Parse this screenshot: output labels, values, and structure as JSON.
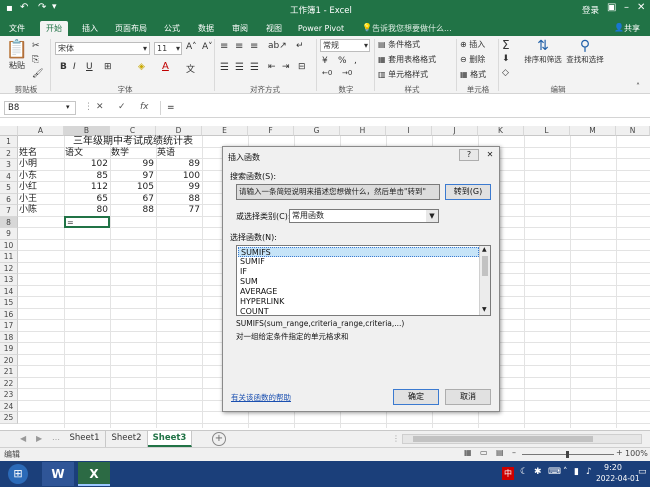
{
  "titlebar": {
    "title": "工作簿1 - Excel",
    "login": "登录"
  },
  "tabs": [
    {
      "label": "文件"
    },
    {
      "label": "开始"
    },
    {
      "label": "插入"
    },
    {
      "label": "页面布局"
    },
    {
      "label": "公式"
    },
    {
      "label": "数据"
    },
    {
      "label": "审阅"
    },
    {
      "label": "视图"
    },
    {
      "label": "Power Pivot"
    }
  ],
  "tell_me": "告诉我您想要做什么...",
  "share": "共享",
  "ribbon": {
    "paste": "粘贴",
    "font_name": "宋体",
    "font_size": "11",
    "bold": "B",
    "italic": "I",
    "underline": "U",
    "font_color_glyph": "A",
    "number_format": "常规",
    "conditional": "条件格式",
    "table_format": "套用表格格式",
    "cell_style": "单元格样式",
    "insert": "插入",
    "delete": "删除",
    "format": "格式",
    "sigma": "Σ",
    "sort_filter": "排序和筛选",
    "find_select": "查找和选择",
    "groups": {
      "clipboard": "剪贴板",
      "font": "字体",
      "alignment": "对齐方式",
      "number": "数字",
      "styles": "样式",
      "cells": "单元格",
      "editing": "编辑"
    }
  },
  "formula_bar": {
    "name_box": "B8",
    "value": "=",
    "fx": "fx",
    "cancel": "✕",
    "enter": "✓"
  },
  "columns": [
    "A",
    "B",
    "C",
    "D",
    "E",
    "F",
    "G",
    "H",
    "I",
    "J",
    "K",
    "L",
    "M",
    "N"
  ],
  "rows": [
    "1",
    "2",
    "3",
    "4",
    "5",
    "6",
    "7",
    "8",
    "9",
    "10",
    "11",
    "12",
    "13",
    "14",
    "15",
    "16",
    "17",
    "18",
    "19",
    "20",
    "21",
    "22",
    "23",
    "24",
    "25"
  ],
  "sheet": {
    "title": "三年级期中考试成绩统计表",
    "headers": [
      "姓名",
      "语文",
      "数学",
      "英语"
    ],
    "data": [
      {
        "name": "小明",
        "chinese": "102",
        "math": "99",
        "english": "89"
      },
      {
        "name": "小东",
        "chinese": "85",
        "math": "97",
        "english": "100"
      },
      {
        "name": "小红",
        "chinese": "112",
        "math": "105",
        "english": "99"
      },
      {
        "name": "小王",
        "chinese": "65",
        "math": "67",
        "english": "88"
      },
      {
        "name": "小陈",
        "chinese": "80",
        "math": "88",
        "english": "77"
      }
    ],
    "active_cell_value": "="
  },
  "dialog": {
    "title": "插入函数",
    "help_btn": "?",
    "search_label": "搜索函数(S):",
    "search_text": "请输入一条简短说明来描述您想做什么，然后单击\"转到\"",
    "goto": "转到(G)",
    "category_label": "或选择类别(C):",
    "category_value": "常用函数",
    "select_label": "选择函数(N):",
    "functions": [
      "SUMIFS",
      "SUMIF",
      "IF",
      "SUM",
      "AVERAGE",
      "HYPERLINK",
      "COUNT"
    ],
    "selected_function": "SUMIFS",
    "syntax": "SUMIFS(sum_range,criteria_range,criteria,...)",
    "description": "对一组给定条件指定的单元格求和",
    "help_link": "有关该函数的帮助",
    "ok": "确定",
    "cancel": "取消"
  },
  "sheet_tabs": [
    {
      "label": "Sheet1"
    },
    {
      "label": "Sheet2"
    },
    {
      "label": "Sheet3"
    }
  ],
  "add_sheet": "+",
  "status": {
    "mode": "编辑",
    "zoom": "100%"
  },
  "taskbar": {
    "time": "9:20",
    "date": "2022-04-01",
    "ime": "中",
    "word": "W",
    "excel": "X"
  },
  "colors": {
    "excel_green": "#217346",
    "selection": "#c6e4f8",
    "taskbar": "#1b3f7a"
  }
}
